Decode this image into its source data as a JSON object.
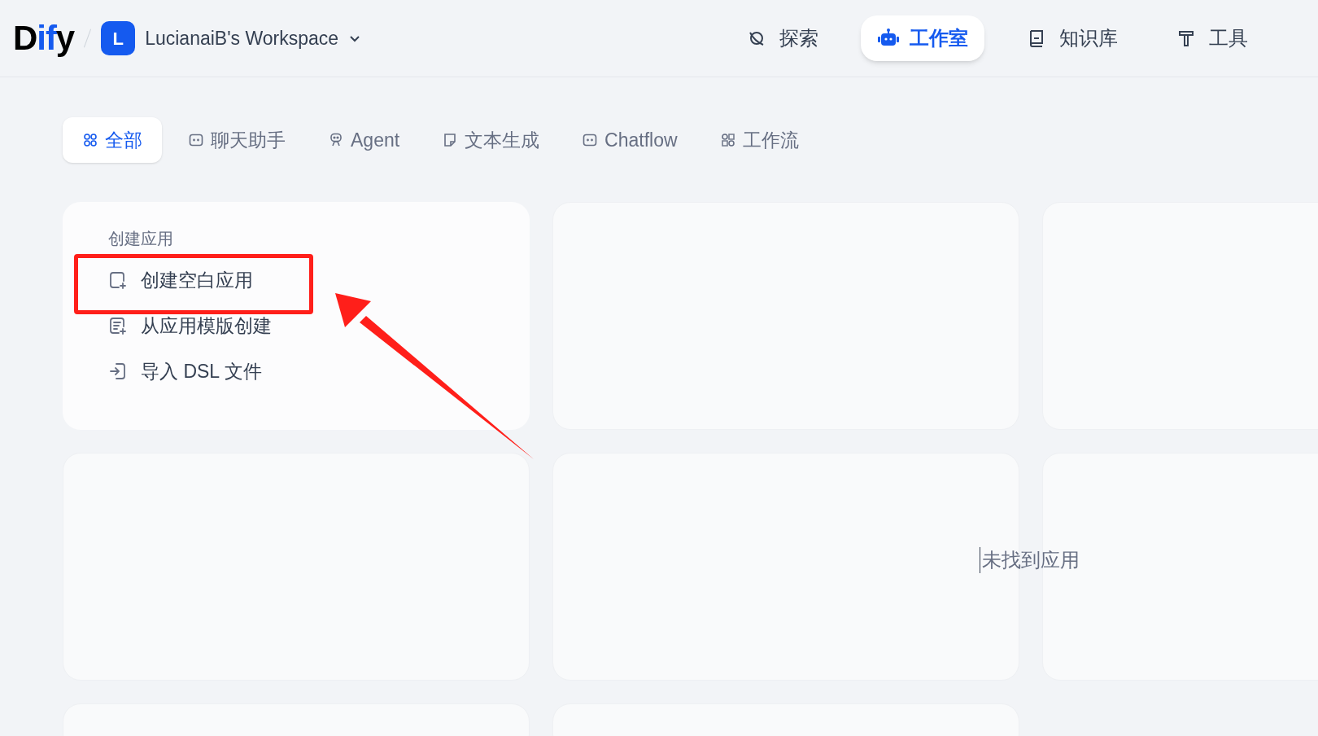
{
  "header": {
    "logo": {
      "dark_part": "D",
      "accent_part": "if",
      "dark_end": "y"
    },
    "workspace": {
      "initial": "L",
      "name": "LucianaiB's Workspace"
    },
    "nav": [
      {
        "label": "探索",
        "kind": "explore",
        "selected": false
      },
      {
        "label": "工作室",
        "kind": "studio",
        "selected": true
      },
      {
        "label": "知识库",
        "kind": "knowledge",
        "selected": false
      },
      {
        "label": "工具",
        "kind": "tools",
        "selected": false
      }
    ]
  },
  "filters": [
    {
      "label": "全部",
      "kind": "all",
      "selected": true
    },
    {
      "label": "聊天助手",
      "kind": "chat",
      "selected": false
    },
    {
      "label": "Agent",
      "kind": "agent",
      "selected": false
    },
    {
      "label": "文本生成",
      "kind": "completion",
      "selected": false
    },
    {
      "label": "Chatflow",
      "kind": "chat",
      "selected": false
    },
    {
      "label": "工作流",
      "kind": "workflow",
      "selected": false
    }
  ],
  "create_card": {
    "title": "创建应用",
    "actions": [
      {
        "label": "创建空白应用",
        "kind": "blank",
        "highlighted": true
      },
      {
        "label": "从应用模版创建",
        "kind": "template",
        "highlighted": false
      },
      {
        "label": "导入 DSL 文件",
        "kind": "import",
        "highlighted": false
      }
    ]
  },
  "empty_state": "未找到应用"
}
